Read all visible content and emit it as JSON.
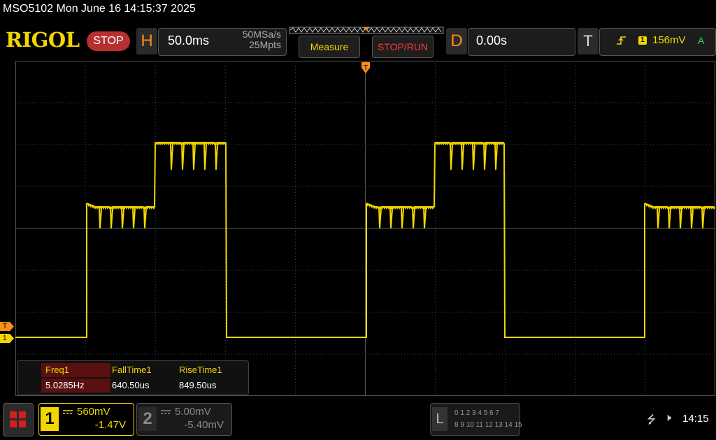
{
  "window": {
    "title": "MSO5102  Mon June 16 14:15:37 2025"
  },
  "brand": {
    "logo": "RIGOL",
    "run_state": "STOP"
  },
  "horizontal": {
    "letter": "H",
    "timebase": "50.0ms",
    "sample_rate": "50MSa/s",
    "memory_depth": "25Mpts"
  },
  "toolbar": {
    "measure_label": "Measure",
    "stoprun_label": "STOP/RUN"
  },
  "delay": {
    "letter": "D",
    "value": "0.00s"
  },
  "trigger": {
    "letter": "T",
    "slope_icon": "rising-edge-icon",
    "source": "1",
    "level": "156mV",
    "mode": "A"
  },
  "markers": {
    "trigger": "T",
    "channel1": "1"
  },
  "measurements": [
    {
      "label": "Freq1",
      "value": "5.0285Hz"
    },
    {
      "label": "FallTime1",
      "value": "640.50us"
    },
    {
      "label": "RiseTime1",
      "value": "849.50us"
    }
  ],
  "channel1": {
    "number": "1",
    "scale": "560mV",
    "offset": "-1.47V"
  },
  "channel2": {
    "number": "2",
    "scale": "5.00mV",
    "offset": "-5.40mV"
  },
  "digital": {
    "letter": "L",
    "row1": "0 1 2 3   4 5 6 7",
    "row2": "8  9 10 11  12 13 14 15"
  },
  "status": {
    "time": "14:15"
  },
  "colors": {
    "ch1": "#f2d600",
    "trigger": "#ff8c1a",
    "stop": "#ff3b3b",
    "mode": "#2fd26a"
  }
}
